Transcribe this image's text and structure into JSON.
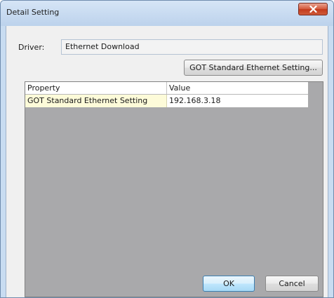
{
  "window": {
    "title": "Detail Setting"
  },
  "driver": {
    "label": "Driver:",
    "value": "Ethernet Download"
  },
  "buttons": {
    "got_setting": "GOT Standard Ethernet Setting...",
    "ok": "OK",
    "cancel": "Cancel"
  },
  "grid": {
    "columns": [
      "Property",
      "Value"
    ],
    "rows": [
      {
        "property": "GOT Standard Ethernet Setting",
        "value": "192.168.3.18"
      }
    ]
  },
  "icons": {
    "close": "close-icon"
  },
  "colors": {
    "selected_cell_bg": "#fdfbd9",
    "grid_empty_bg": "#a9a9ab",
    "close_button": "#c23a1c"
  }
}
